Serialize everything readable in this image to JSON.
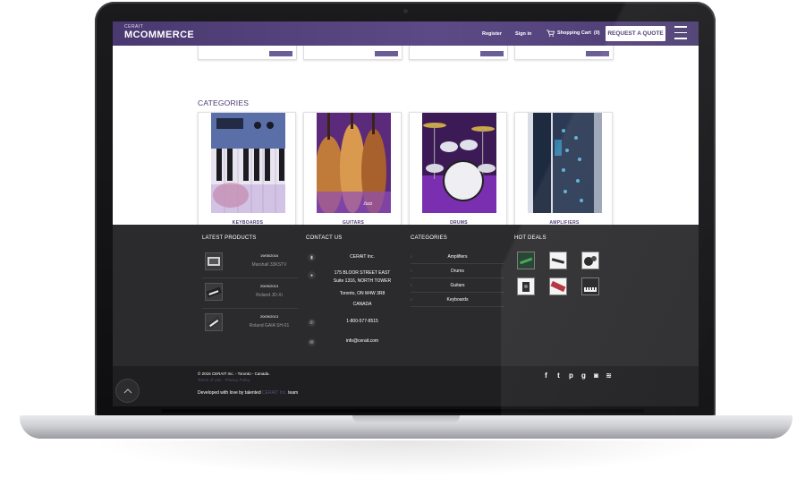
{
  "header": {
    "logo_small": "CERAIT",
    "logo_main": "MCOMMERCE",
    "register": "Register",
    "sign_in": "Sign in",
    "cart_label": "Shopping Cart",
    "cart_count": "(0)",
    "quote_button": "REQUEST A QUOTE"
  },
  "categories": {
    "heading": "CATEGORIES",
    "items": [
      {
        "label": "KEYBOARDS"
      },
      {
        "label": "GUITARS"
      },
      {
        "label": "DRUMS"
      },
      {
        "label": "AMPLIFIERS"
      }
    ]
  },
  "footer": {
    "latest_products": {
      "heading": "LATEST PRODUCTS",
      "items": [
        {
          "date": "19/05/2016",
          "name": "Marshall 33KSTV"
        },
        {
          "date": "20/09/2013",
          "name": "Roland JD-Xi"
        },
        {
          "date": "20/09/2013",
          "name": "Roland GAIA SH-01"
        }
      ]
    },
    "contact": {
      "heading": "CONTACT US",
      "company": "CERAIT Inc.",
      "address_1": "175 BLOOR STREET EAST",
      "address_2": "Suite 1316, NORTH TOWER",
      "address_3": "Toronto, ON M4W 3R8",
      "address_4": "CANADA",
      "phone": "1-800-577-8515",
      "email": "info@cerait.com"
    },
    "categories": {
      "heading": "CATEGORIES",
      "links": [
        "Amplifiers",
        "Drums",
        "Guitars",
        "Keyboards"
      ]
    },
    "hot_deals": {
      "heading": "HOT DEALS"
    }
  },
  "subfooter": {
    "copyright": "© 2016 CERAIT Inc. - Toronto - Canada.",
    "policy": "Terms of Use · Privacy Policy",
    "dev_prefix": "Developed with love by talented",
    "dev_brand": "CERAIT Inc.",
    "dev_suffix": "team"
  },
  "colors": {
    "brand_purple": "#4a3870",
    "footer_dark": "#2b2a2c",
    "subfooter_dark": "#1f1e20"
  },
  "icons": {
    "cart": "shopping-cart-icon",
    "menu": "hamburger-menu-icon",
    "back_to_top": "chevron-up-icon",
    "socials": [
      "facebook-icon",
      "twitter-icon",
      "pinterest-icon",
      "google-plus-icon",
      "instagram-icon",
      "rss-icon"
    ]
  }
}
